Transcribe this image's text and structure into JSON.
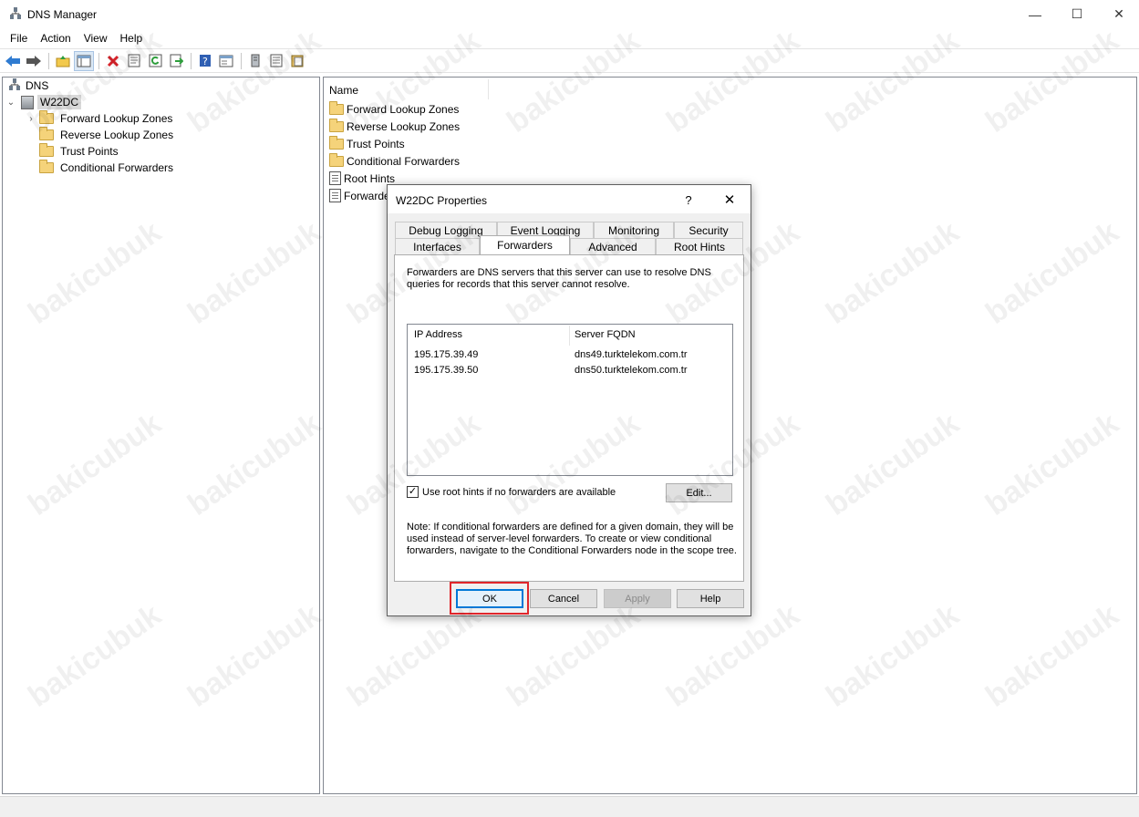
{
  "window": {
    "title": "DNS Manager",
    "minimize": "—",
    "maximize": "☐",
    "close": "✕"
  },
  "menu": [
    "File",
    "Action",
    "View",
    "Help"
  ],
  "tree": {
    "root": "DNS",
    "server": "W22DC",
    "children": [
      "Forward Lookup Zones",
      "Reverse Lookup Zones",
      "Trust Points",
      "Conditional Forwarders"
    ]
  },
  "list": {
    "header": "Name",
    "items": [
      "Forward Lookup Zones",
      "Reverse Lookup Zones",
      "Trust Points",
      "Conditional Forwarders",
      "Root Hints",
      "Forwarde"
    ]
  },
  "dialog": {
    "title": "W22DC Properties",
    "help": "?",
    "close": "✕",
    "tabs_row1": [
      "Debug Logging",
      "Event Logging",
      "Monitoring",
      "Security"
    ],
    "tabs_row2": [
      "Interfaces",
      "Forwarders",
      "Advanced",
      "Root Hints"
    ],
    "active_tab": "Forwarders",
    "description": "Forwarders are DNS servers that this server can use to resolve DNS queries for records that this server cannot resolve.",
    "columns": [
      "IP Address",
      "Server FQDN"
    ],
    "forwarders": [
      {
        "ip": "195.175.39.49",
        "fqdn": "dns49.turktelekom.com.tr"
      },
      {
        "ip": "195.175.39.50",
        "fqdn": "dns50.turktelekom.com.tr"
      }
    ],
    "use_root_hints_label": "Use root hints if no forwarders are available",
    "use_root_hints_checked": true,
    "edit_button": "Edit...",
    "note": "Note: If conditional forwarders are defined for a given domain, they will be used instead of server-level forwarders.  To create or view conditional forwarders, navigate to the Conditional Forwarders node in the scope tree.",
    "buttons": {
      "ok": "OK",
      "cancel": "Cancel",
      "apply": "Apply",
      "help": "Help"
    }
  },
  "watermark": "bakicubuk",
  "colors": {
    "highlight": "#e0262b",
    "accent": "#0078d7"
  }
}
